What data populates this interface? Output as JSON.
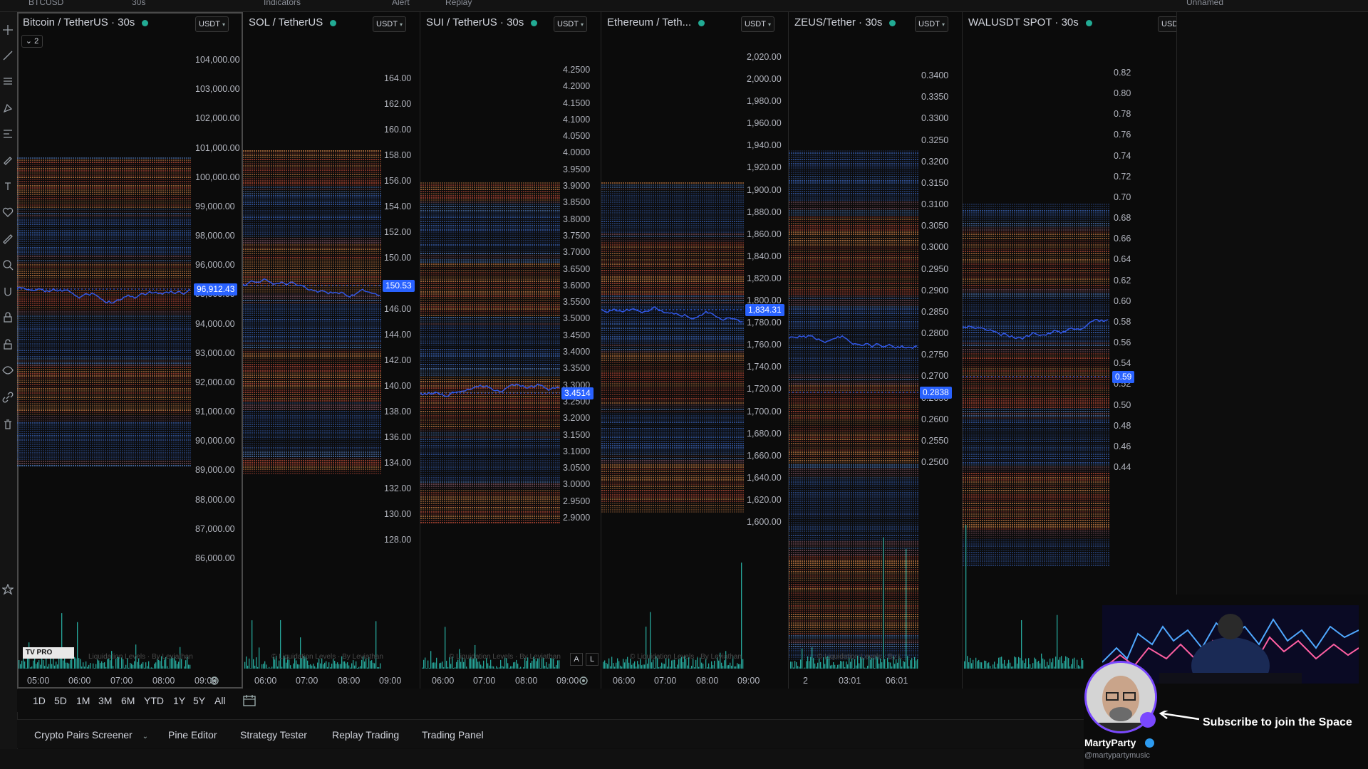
{
  "topbar": {
    "items": [
      "BTCUSD",
      "30s",
      "Indicators",
      "Alert",
      "Replay",
      "Unnamed"
    ]
  },
  "panes": [
    {
      "title": "Bitcoin / TetherUS · 30s",
      "currency": "USDT",
      "collapse": "2",
      "price": "96,912.43",
      "yticks": [
        "104,000.00",
        "103,000.00",
        "102,000.00",
        "101,000.00",
        "100,000.00",
        "99,000.00",
        "98,000.00",
        "96,000.00",
        "95,000.00",
        "94,000.00",
        "93,000.00",
        "92,000.00",
        "91,000.00",
        "90,000.00",
        "89,000.00",
        "88,000.00",
        "87,000.00",
        "86,000.00"
      ],
      "xticks": [
        "05:00",
        "06:00",
        "07:00",
        "08:00",
        "09:00"
      ],
      "watermark": "Liquidation Levels · By Leviathan",
      "active": true
    },
    {
      "title": "SOL / TetherUS",
      "currency": "USDT",
      "price": "150.53",
      "yticks": [
        "164.00",
        "162.00",
        "160.00",
        "158.00",
        "156.00",
        "154.00",
        "152.00",
        "150.00",
        "148.00",
        "146.00",
        "144.00",
        "142.00",
        "140.00",
        "138.00",
        "136.00",
        "134.00",
        "132.00",
        "130.00",
        "128.00"
      ],
      "xticks": [
        "06:00",
        "07:00",
        "08:00",
        "09:00"
      ],
      "watermark": "© Liquidation Levels · By Leviathan"
    },
    {
      "title": "SUI / TetherUS · 30s",
      "currency": "USDT",
      "price": "3.4514",
      "yticks": [
        "4.2500",
        "4.2000",
        "4.1500",
        "4.1000",
        "4.0500",
        "4.0000",
        "3.9500",
        "3.9000",
        "3.8500",
        "3.8000",
        "3.7500",
        "3.7000",
        "3.6500",
        "3.6000",
        "3.5500",
        "3.5000",
        "3.4500",
        "3.4000",
        "3.3500",
        "3.3000",
        "3.2500",
        "3.2000",
        "3.1500",
        "3.1000",
        "3.0500",
        "3.0000",
        "2.9500",
        "2.9000"
      ],
      "xticks": [
        "06:00",
        "07:00",
        "08:00",
        "09:00"
      ],
      "watermark": "© Liquidation Levels · By Leviathan",
      "auto": "A",
      "log": "L"
    },
    {
      "title": "Ethereum / Teth...",
      "currency": "USDT",
      "price": "1,834.31",
      "yticks": [
        "2,020.00",
        "2,000.00",
        "1,980.00",
        "1,960.00",
        "1,940.00",
        "1,920.00",
        "1,900.00",
        "1,880.00",
        "1,860.00",
        "1,840.00",
        "1,820.00",
        "1,800.00",
        "1,780.00",
        "1,760.00",
        "1,740.00",
        "1,720.00",
        "1,700.00",
        "1,680.00",
        "1,660.00",
        "1,640.00",
        "1,620.00",
        "1,600.00"
      ],
      "xticks": [
        "06:00",
        "07:00",
        "08:00",
        "09:00"
      ],
      "watermark": "© Liquidation Levels · By Leviathan"
    },
    {
      "title": "ZEUS/Tether · 30s",
      "currency": "USDT",
      "price": "0.2838",
      "yticks": [
        "0.3400",
        "0.3350",
        "0.3300",
        "0.3250",
        "0.3200",
        "0.3150",
        "0.3100",
        "0.3050",
        "0.3000",
        "0.2950",
        "0.2900",
        "0.2850",
        "0.2800",
        "0.2750",
        "0.2700",
        "0.2650",
        "0.2600",
        "0.2550",
        "0.2500"
      ],
      "xticks": [
        "2",
        "03:01",
        "06:01"
      ],
      "watermark": "© Liquidation Levels · By L"
    },
    {
      "title": "WALUSDT SPOT · 30s",
      "currency": "USDT",
      "price": "0.59",
      "yticks": [
        "0.82",
        "0.80",
        "0.78",
        "0.76",
        "0.74",
        "0.72",
        "0.70",
        "0.68",
        "0.66",
        "0.64",
        "0.62",
        "0.60",
        "0.58",
        "0.56",
        "0.54",
        "0.52",
        "0.50",
        "0.48",
        "0.46",
        "0.44"
      ],
      "xticks": [],
      "watermark": ""
    }
  ],
  "timeframes": [
    "1D",
    "5D",
    "1M",
    "3M",
    "6M",
    "YTD",
    "1Y",
    "5Y",
    "All"
  ],
  "bottom_tabs": [
    "Crypto Pairs Screener",
    "Pine Editor",
    "Strategy Tester",
    "Replay Trading",
    "Trading Panel"
  ],
  "overlay": {
    "subscribe": "Subscribe to join the Space",
    "name": "MartyParty",
    "handle": "@martypartymusic"
  },
  "colors": {
    "accent": "#2962ff",
    "line": "#3158e8",
    "volume": "#26a69a",
    "dot": "#22ab94",
    "verified": "#2d9bf0",
    "badge": "#7a48ff"
  },
  "icons": [
    "crosshair-icon",
    "trendline-icon",
    "fib-icon",
    "pattern-icon",
    "forecast-icon",
    "brush-icon",
    "text-icon",
    "heart-icon",
    "ruler-icon",
    "zoom-icon",
    "magnet-icon",
    "lock-drawing-icon",
    "lock-icon",
    "eye-icon",
    "link-icon",
    "trash-icon",
    "star-icon"
  ]
}
